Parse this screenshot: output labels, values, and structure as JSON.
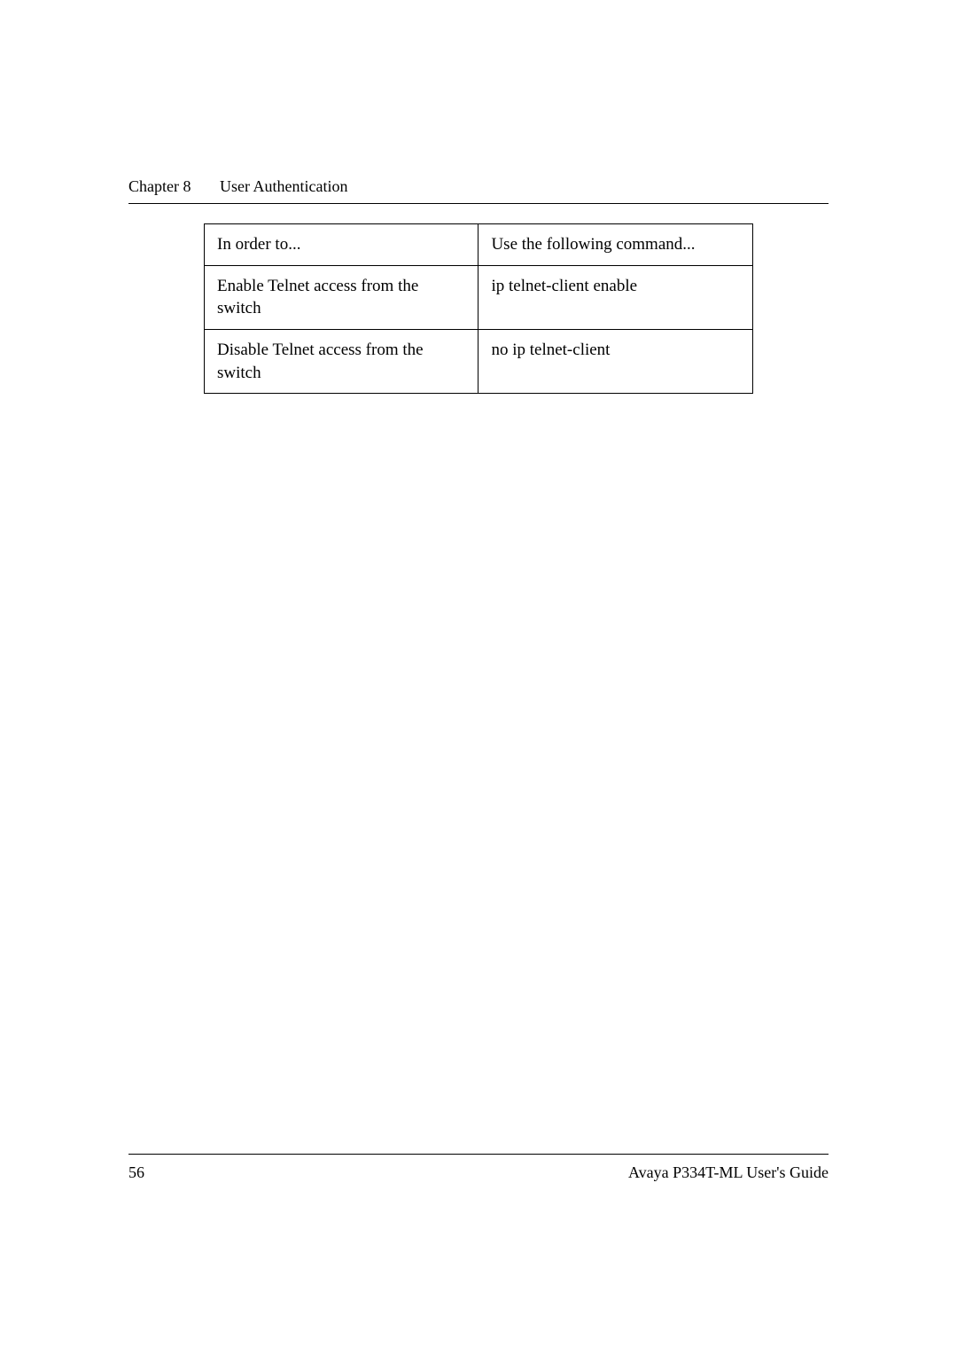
{
  "header": {
    "chapter": "Chapter 8",
    "title": "User Authentication"
  },
  "table": {
    "header": {
      "col1": "In order to...",
      "col2": "Use the following command..."
    },
    "rows": [
      {
        "col1": "Enable Telnet access from the switch",
        "col2": "ip telnet-client enable"
      },
      {
        "col1": "Disable Telnet access from the switch",
        "col2": "no ip telnet-client"
      }
    ]
  },
  "footer": {
    "page_number": "56",
    "guide_title": "Avaya P334T-ML User's Guide"
  }
}
